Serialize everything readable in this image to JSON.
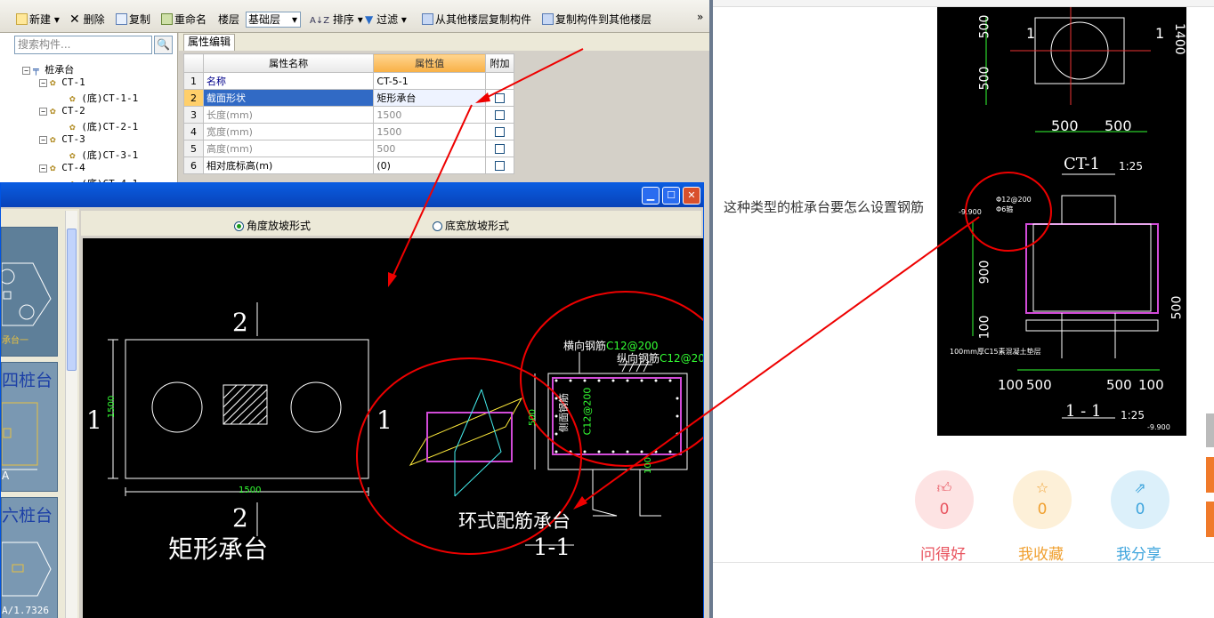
{
  "toolbar": {
    "new": "新建",
    "delete": "删除",
    "copy": "复制",
    "rename": "重命名",
    "floor_label": "楼层",
    "floor_value": "基础层",
    "sort": "排序",
    "filter": "过滤",
    "copy_from": "从其他楼层复制构件",
    "copy_to": "复制构件到其他楼层",
    "more": "»"
  },
  "search": {
    "placeholder": "搜索构件..."
  },
  "tree": {
    "root": "桩承台",
    "items": [
      {
        "label": "CT-1",
        "child": "(底)CT-1-1"
      },
      {
        "label": "CT-2",
        "child": "(底)CT-2-1"
      },
      {
        "label": "CT-3",
        "child": "(底)CT-3-1"
      },
      {
        "label": "CT-4",
        "child": "(底)CT-4-1"
      }
    ]
  },
  "props": {
    "tab": "属性编辑",
    "col_name": "属性名称",
    "col_value": "属性值",
    "col_extra": "附加",
    "rows": [
      {
        "n": "1",
        "name": "名称",
        "value": "CT-5-1"
      },
      {
        "n": "2",
        "name": "截面形状",
        "value": "矩形承台"
      },
      {
        "n": "3",
        "name": "长度(mm)",
        "value": "1500"
      },
      {
        "n": "4",
        "name": "宽度(mm)",
        "value": "1500"
      },
      {
        "n": "5",
        "name": "高度(mm)",
        "value": "500"
      },
      {
        "n": "6",
        "name": "相对底标高(m)",
        "value": "(0)"
      }
    ]
  },
  "dialog": {
    "radio1": "角度放坡形式",
    "radio2": "底宽放坡形式",
    "thumb_labels": [
      "承台一",
      "四桩台",
      "六桩台"
    ],
    "thumb_tag_a": "A",
    "thumb_ratio": "A/1.7326"
  },
  "drawing": {
    "section_mark": "2",
    "side_mark": "1",
    "dim_width": "1500",
    "dim_height": "1500",
    "title_left": "矩形承台",
    "title_right": "环式配筋承台",
    "section_title": "1-1",
    "label_horizontal": "横向钢筋",
    "label_horizontal_spec": "C12@200",
    "label_vertical": "纵向钢筋",
    "label_vertical_spec": "C12@20",
    "label_side": "侧面钢筋",
    "label_side_spec": "C12@200",
    "dim_500": "500",
    "dim_100": "100"
  },
  "right": {
    "question": "这种类型的桩承台要怎么设置钢筋",
    "actions": [
      {
        "label": "问得好",
        "count": "0",
        "icon": "thumbs-up-icon",
        "color": "#e8545f",
        "bg": "#fde3e3"
      },
      {
        "label": "我收藏",
        "count": "0",
        "icon": "star-icon",
        "color": "#f0a030",
        "bg": "#fdf0d8"
      },
      {
        "label": "我分享",
        "count": "0",
        "icon": "share-icon",
        "color": "#3fa5dd",
        "bg": "#dcf0fa"
      }
    ]
  },
  "detail": {
    "dim500a": "500",
    "dim500b": "500",
    "mark1": "1",
    "ct_title": "CT-1",
    "scale1": "1:25",
    "rebar": "Φ12@200",
    "rebar2": "Φ6箍",
    "elev": "-9.900",
    "h900": "900",
    "h100": "100",
    "h500": "500",
    "h1400": "1400",
    "bed": "100mm厚C15素混凝土垫层",
    "bot_dims": [
      "100",
      "500",
      "500",
      "100"
    ],
    "sec_title": "1 - 1",
    "scale2": "1:25",
    "elev2": "-9.900"
  }
}
